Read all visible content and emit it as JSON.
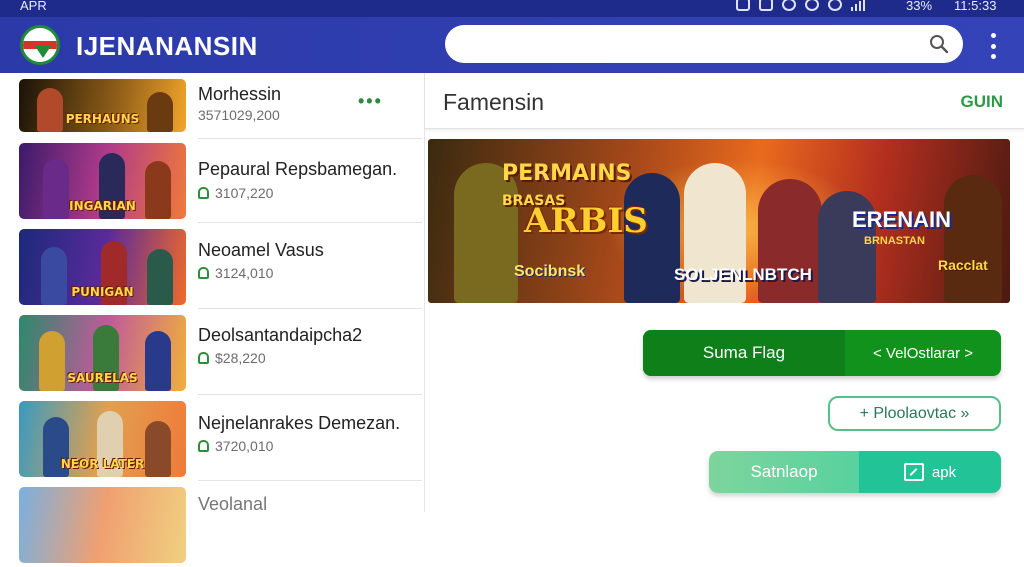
{
  "status_bar": {
    "left_text": "APR",
    "battery": "33%",
    "time": "11:5:33"
  },
  "header": {
    "title": "IJENANANSIN",
    "search": {
      "placeholder": "",
      "icon": "search-icon"
    },
    "menu_icon": "more-vertical-icon"
  },
  "list": {
    "more_label": "•••",
    "items": [
      {
        "title": "Morhessin",
        "subtitle": "3571029,200",
        "thumb_caption": "PERHAUNS",
        "colors": [
          "#1a1208",
          "#8a5a18",
          "#f2a52a"
        ]
      },
      {
        "title": "Pepaural Repsbamegan.",
        "subtitle": "3107,220",
        "thumb_caption": "INGARIAN",
        "colors": [
          "#3a1a6a",
          "#b03a8a",
          "#f07a3a"
        ]
      },
      {
        "title": "Neoamel Vasus",
        "subtitle": "3124,010",
        "thumb_caption": "PUNIGAN",
        "colors": [
          "#1a2a7a",
          "#5a2a9a",
          "#f06a2a"
        ]
      },
      {
        "title": "Deolsantandaipcha2",
        "subtitle": "$28,220",
        "thumb_caption": "SAURELAS",
        "colors": [
          "#2a8a6a",
          "#c05a9a",
          "#f0b03a"
        ]
      },
      {
        "title": "Nejnelanrakes Demezan.",
        "subtitle": "3720,010",
        "thumb_caption": "NEOR LATER",
        "colors": [
          "#3a9ac0",
          "#e0a050",
          "#f07a3a"
        ]
      },
      {
        "title": "Veolanal",
        "subtitle": "",
        "thumb_caption": "",
        "colors": [
          "#7ab0e0",
          "#f0a070",
          "#f0d080"
        ]
      }
    ]
  },
  "detail": {
    "title": "Famensin",
    "action_label": "GUIN",
    "banner": {
      "title": "PERMAINS",
      "subtitle": "BRASAS",
      "logo_text": "ARBIS",
      "left_label": "Socibnsk",
      "center_label": "SOLJENLNBTCH",
      "right_title": "ERENAIN",
      "right_subtitle": "BRNASTAN",
      "corner_text": "Racclat"
    },
    "primary_button": {
      "left": "Suma Flag",
      "right": "< VelOstlarar >"
    },
    "outline_button": "+ Ploolaovtac »",
    "download_button": {
      "left": "Satnlaop",
      "right": "apk"
    }
  }
}
